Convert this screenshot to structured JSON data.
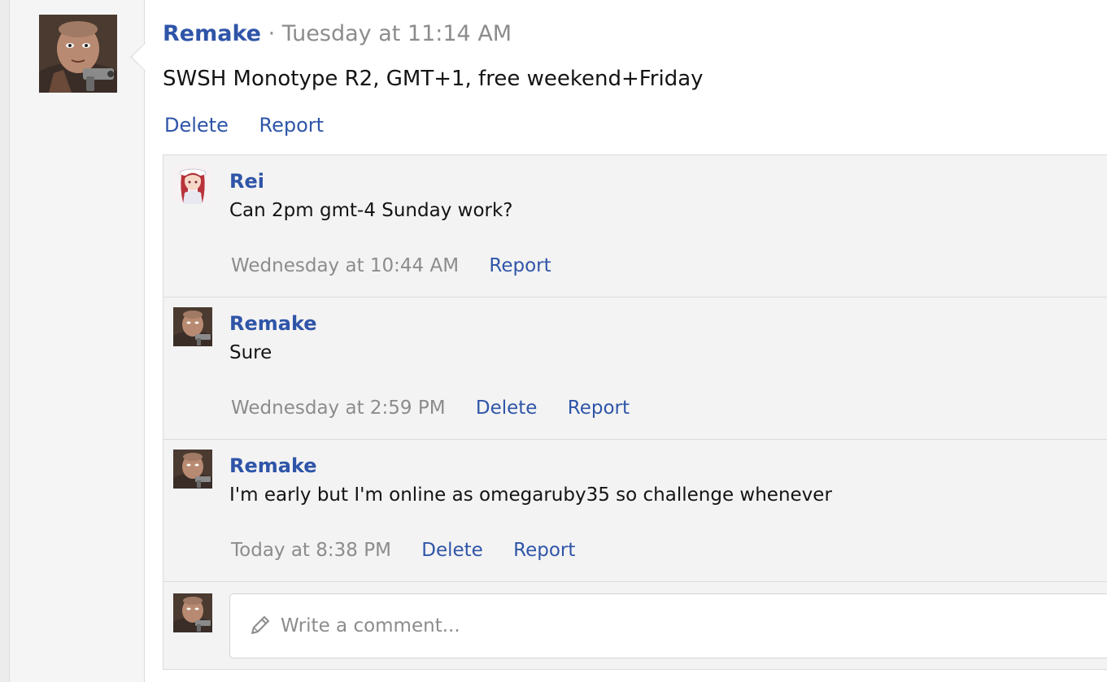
{
  "post": {
    "author": "Remake",
    "separator": "·",
    "time": "Tuesday at 11:14 AM",
    "body": "SWSH Monotype R2, GMT+1, free weekend+Friday",
    "actions": {
      "delete": "Delete",
      "report": "Report"
    }
  },
  "comments": [
    {
      "author": "Rei",
      "text": "Can 2pm gmt-4 Sunday work?",
      "time": "Wednesday at 10:44 AM",
      "delete": null,
      "report": "Report"
    },
    {
      "author": "Remake",
      "text": "Sure",
      "time": "Wednesday at 2:59 PM",
      "delete": "Delete",
      "report": "Report"
    },
    {
      "author": "Remake",
      "text": "I'm early but I'm online as omegaruby35 so challenge whenever",
      "time": "Today at 8:38 PM",
      "delete": "Delete",
      "report": "Report"
    }
  ],
  "composer": {
    "placeholder": "Write a comment...",
    "icon": "pencil-icon"
  },
  "colors": {
    "link": "#2f55a8",
    "muted": "#8c8c8c",
    "comment_bg": "#f3f3f3",
    "border": "#dcdcdc"
  }
}
